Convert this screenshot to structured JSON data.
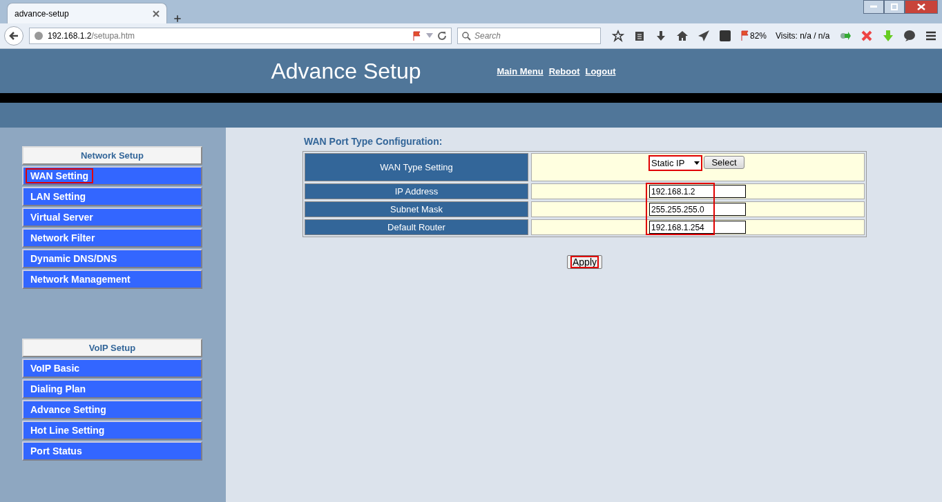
{
  "browser": {
    "tab_title": "advance-setup",
    "url_host": "192.168.1.2",
    "url_path": "/setupa.htm",
    "search": {
      "placeholder": "Search"
    },
    "zoom_reading": "82%",
    "visits": "Visits: n/a / n/a"
  },
  "header": {
    "title": "Advance Setup",
    "links": [
      "Main Menu",
      "Reboot",
      "Logout"
    ]
  },
  "sidebar": {
    "groups": [
      {
        "title": "Network Setup",
        "items": [
          {
            "label": "WAN Setting",
            "highlighted": true
          },
          {
            "label": "LAN Setting",
            "highlighted": false
          },
          {
            "label": "Virtual Server",
            "highlighted": false
          },
          {
            "label": "Network Filter",
            "highlighted": false
          },
          {
            "label": "Dynamic DNS/DNS",
            "highlighted": false
          },
          {
            "label": "Network Management",
            "highlighted": false
          }
        ]
      },
      {
        "title": "VoIP Setup",
        "items": [
          {
            "label": "VoIP Basic",
            "highlighted": false
          },
          {
            "label": "Dialing Plan",
            "highlighted": false
          },
          {
            "label": "Advance Setting",
            "highlighted": false
          },
          {
            "label": "Hot Line Setting",
            "highlighted": false
          },
          {
            "label": "Port Status",
            "highlighted": false
          }
        ]
      }
    ]
  },
  "form": {
    "title": "WAN Port Type Configuration:",
    "type_row": {
      "label": "WAN Type Setting",
      "value": "Static IP",
      "highlighted": true,
      "button": "Select"
    },
    "fields_highlighted": true,
    "fields": [
      {
        "label": "IP Address",
        "value": "192.168.1.2"
      },
      {
        "label": "Subnet Mask",
        "value": "255.255.255.0"
      },
      {
        "label": "Default Router",
        "value": "192.168.1.254"
      }
    ],
    "apply": {
      "label": "Apply",
      "highlighted": true
    }
  }
}
